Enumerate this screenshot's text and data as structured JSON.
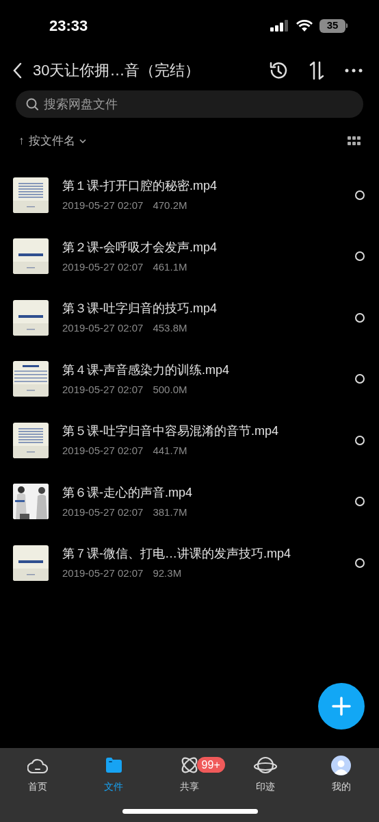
{
  "status_bar": {
    "time": "23:33",
    "battery": "35"
  },
  "header": {
    "title": "30天让你拥…音（完结）"
  },
  "search": {
    "placeholder": "搜索网盘文件"
  },
  "sort": {
    "arrow": "↑",
    "label": "按文件名"
  },
  "files": [
    {
      "name": "第１课-打开口腔的秘密.mp4",
      "date": "2019-05-27 02:07",
      "size": "470.2M",
      "selected": false
    },
    {
      "name": "第２课-会呼吸才会发声.mp4",
      "date": "2019-05-27 02:07",
      "size": "461.1M",
      "selected": false
    },
    {
      "name": "第３课-吐字归音的技巧.mp4",
      "date": "2019-05-27 02:07",
      "size": "453.8M",
      "selected": false
    },
    {
      "name": "第４课-声音感染力的训练.mp4",
      "date": "2019-05-27 02:07",
      "size": "500.0M",
      "selected": false
    },
    {
      "name": "第５课-吐字归音中容易混淆的音节.mp4",
      "date": "2019-05-27 02:07",
      "size": "441.7M",
      "selected": false
    },
    {
      "name": "第６课-走心的声音.mp4",
      "date": "2019-05-27 02:07",
      "size": "381.7M",
      "selected": false
    },
    {
      "name": "第７课-微信、打电…讲课的发声技巧.mp4",
      "date": "2019-05-27 02:07",
      "size": "92.3M",
      "selected": false
    }
  ],
  "tabs": [
    {
      "kind": "home",
      "label": "首页",
      "selected": false
    },
    {
      "kind": "files",
      "label": "文件",
      "selected": true
    },
    {
      "kind": "share",
      "label": "共享",
      "selected": false,
      "badge": "99+"
    },
    {
      "kind": "trace",
      "label": "印迹",
      "selected": false
    },
    {
      "kind": "me",
      "label": "我的",
      "selected": false
    }
  ]
}
